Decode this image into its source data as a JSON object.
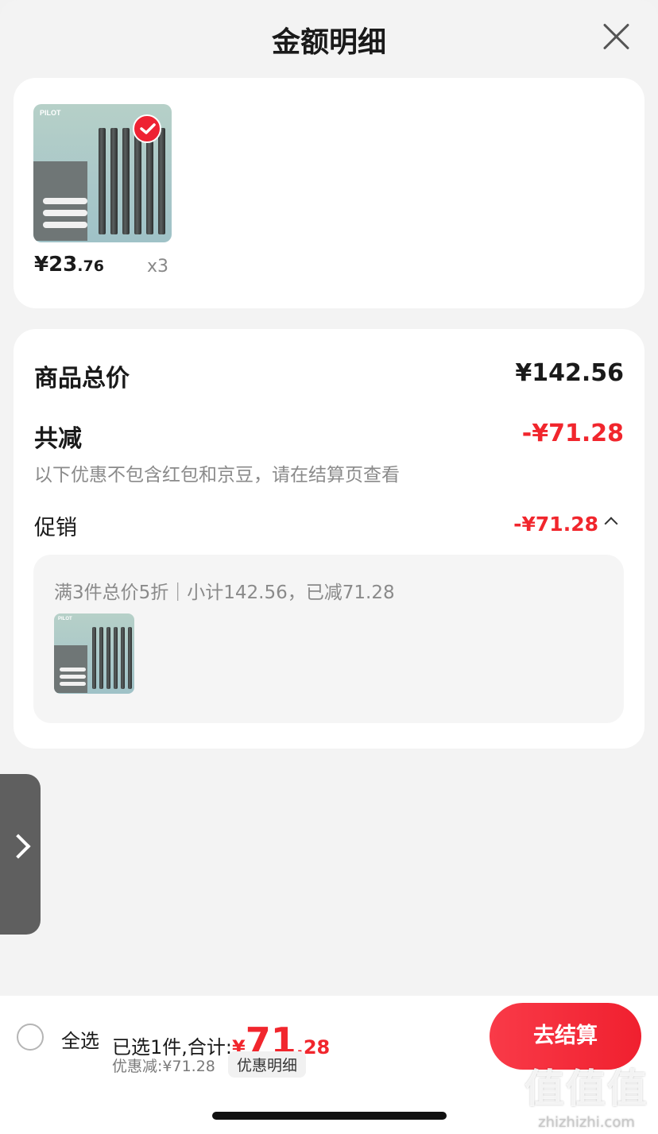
{
  "header": {
    "title": "金额明细"
  },
  "product": {
    "brand": "PILOT",
    "price_main": "¥23",
    "price_cents": ".76",
    "quantity": "x3",
    "selected": true
  },
  "summary": {
    "total_label": "商品总价",
    "total_value": "¥142.56",
    "reduce_label": "共减",
    "reduce_value": "-¥71.28",
    "note": "以下优惠不包含红包和京豆，请在结算页查看",
    "promo_label": "促销",
    "promo_value": "-¥71.28",
    "promo_desc": "满3件总价5折｜小计142.56，已减71.28"
  },
  "bottom_bar": {
    "select_all": "全选",
    "selected_text": "已选1件,合计:",
    "total_symbol": "¥",
    "total_int": "71",
    "total_dec": ".28",
    "discount_text": "优惠减:¥71.28",
    "detail_link": "优惠明细",
    "checkout": "去结算"
  },
  "watermark": {
    "big": "值值值",
    "small": "zhizhizhi.com"
  },
  "colors": {
    "accent_red": "#f1262d",
    "background": "#f3f3f3",
    "card": "#ffffff"
  }
}
